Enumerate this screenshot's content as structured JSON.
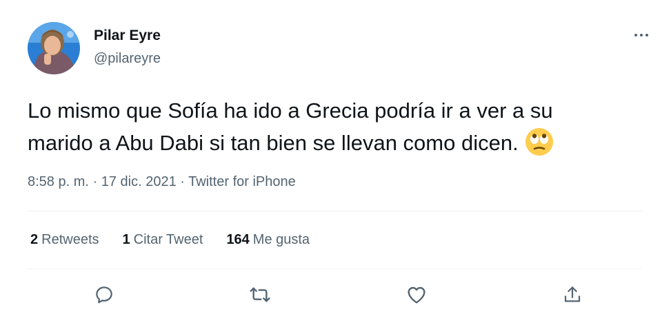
{
  "author": {
    "name": "Pilar Eyre",
    "handle": "@pilareyre"
  },
  "tweet": {
    "line1": "Lo mismo que Sofía ha ido a Grecia podría ir a ver a su",
    "line2": "marido a Abu Dabi si tan bien se llevan como dicen.",
    "emoji": "rolling-eyes-emoji"
  },
  "meta": {
    "time": "8:58 p. m.",
    "sep1": " · ",
    "date": "17 dic. 2021",
    "sep2": " · ",
    "source": "Twitter for iPhone"
  },
  "stats": {
    "retweets_count": "2",
    "retweets_label": "Retweets",
    "quotes_count": "1",
    "quotes_label": "Citar Tweet",
    "likes_count": "164",
    "likes_label": "Me gusta"
  },
  "actions": [
    "reply-icon",
    "retweet-icon",
    "like-icon",
    "share-icon"
  ],
  "colors": {
    "text": "#0f1419",
    "secondary": "#536471",
    "divider": "#eff3f4",
    "avatar_bg": "#2a7fd4"
  }
}
